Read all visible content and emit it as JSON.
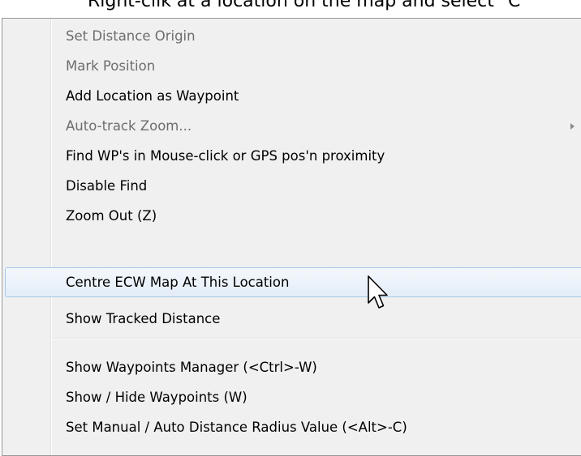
{
  "instruction": {
    "text": "Right-clik at a location on the map and select \"C"
  },
  "menu": {
    "items": [
      {
        "label": "Set Distance Origin",
        "enabled": false
      },
      {
        "label": "Mark Position",
        "enabled": false
      },
      {
        "label": "Add Location as Waypoint",
        "enabled": true
      },
      {
        "label": "Auto-track Zoom...",
        "enabled": false,
        "has_submenu": true
      },
      {
        "label": "Find WP's in Mouse-click or GPS pos'n proximity",
        "enabled": true
      },
      {
        "label": "Disable Find",
        "enabled": true
      },
      {
        "label": "Zoom Out (Z)",
        "enabled": true
      },
      {
        "label": "Centre ECW Map At This Location",
        "enabled": true,
        "highlighted": true
      },
      {
        "label": "Show Tracked Distance",
        "enabled": true
      },
      {
        "label": "Show Waypoints Manager (<Ctrl>-W)",
        "enabled": true
      },
      {
        "label": "Show / Hide Waypoints (W)",
        "enabled": true
      },
      {
        "label": "Set Manual / Auto Distance Radius Value (<Alt>-C)",
        "enabled": true
      }
    ]
  },
  "colors": {
    "menu_background": "#f0f0f0",
    "disabled_text": "#6d6d6d",
    "highlight_border": "#a8c8ec",
    "highlight_fill": "#e3edf8"
  },
  "icons": {
    "submenu": "chevron-right-icon",
    "cursor": "mouse-pointer-icon"
  }
}
